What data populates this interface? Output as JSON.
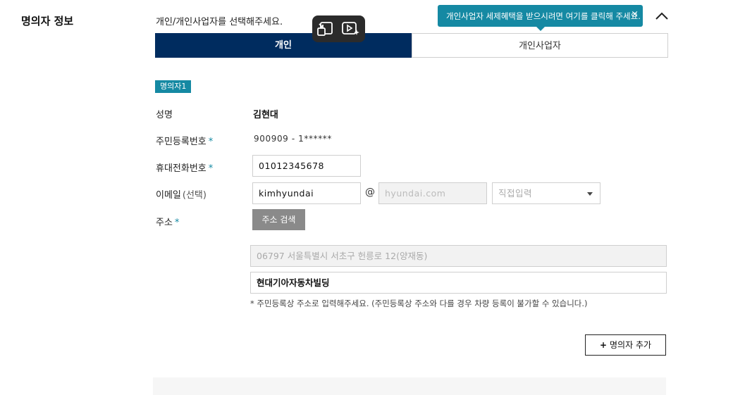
{
  "section": {
    "title": "명의자 정보"
  },
  "instruction": "개인/개인사업자를 선택해주세요.",
  "tooltip": {
    "text": "개인사업자 세제혜택을 받으시려면 여기를 클릭해 주세요.",
    "close": "×"
  },
  "tabs": [
    {
      "label": "개인",
      "active": true
    },
    {
      "label": "개인사업자",
      "active": false
    }
  ],
  "holder": {
    "badge": "명의자1"
  },
  "fields": {
    "name": {
      "label": "성명",
      "value": "김현대"
    },
    "rrn": {
      "label": "주민등록번호",
      "required": "*",
      "value": "900909 - 1******"
    },
    "phone": {
      "label": "휴대전화번호",
      "required": "*",
      "value": "01012345678"
    },
    "email": {
      "label": "이메일",
      "optional": "(선택)",
      "local": "kimhyundai",
      "at": "@",
      "domain": "hyundai.com",
      "select_value": "직접입력"
    },
    "address": {
      "label": "주소",
      "required": "*",
      "search_button": "주소 검색",
      "base": "06797 서울특별시 서초구 헌릉로 12(양재동)",
      "detail": "현대기아자동차빌딩",
      "note": "* 주민등록상 주소로 입력해주세요. (주민등록상 주소와 다를 경우 차량 등록이 불가할 수 있습니다.)"
    }
  },
  "add_holder_button": {
    "icon": "+",
    "label": "명의자 추가"
  },
  "colors": {
    "navy": "#002c5f",
    "teal": "#1589a3",
    "gray_button": "#8a8a8a"
  },
  "icons": [
    "chevron-up-icon",
    "close-icon",
    "picture-in-picture-icon",
    "video-sparkle-icon",
    "dropdown-arrow-icon",
    "plus-icon"
  ]
}
